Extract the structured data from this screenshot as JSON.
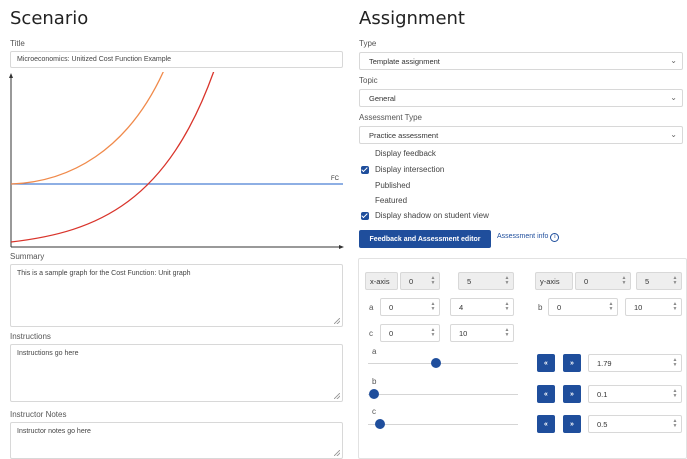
{
  "scenario": {
    "heading": "Scenario",
    "title_label": "Title",
    "title_value": "Microeconomics: Unitized Cost Function Example",
    "graph": {
      "line_label": "FC",
      "colors": {
        "fc": "#4a7fd4",
        "orange": "#f08a4b",
        "red": "#d9342b"
      }
    },
    "summary_label": "Summary",
    "summary_value": "This is a sample graph for the Cost Function: Unit graph",
    "instructions_label": "Instructions",
    "instructions_value": "Instructions go here",
    "notes_label": "Instructor Notes",
    "notes_value": "Instructor notes go here"
  },
  "assignment": {
    "heading": "Assignment",
    "type_label": "Type",
    "type_value": "Template assignment",
    "topic_label": "Topic",
    "topic_value": "General",
    "assessment_type_label": "Assessment Type",
    "assessment_type_value": "Practice assessment",
    "options": {
      "display_feedback": {
        "label": "Display feedback",
        "checked": false
      },
      "display_intersection": {
        "label": "Display intersection",
        "checked": true
      },
      "published": {
        "label": "Published",
        "checked": false
      },
      "featured": {
        "label": "Featured",
        "checked": false
      },
      "display_shadow": {
        "label": "Display shadow on student view",
        "checked": true
      }
    },
    "feedback_button": "Feedback and Assessment editor",
    "assessment_info_link": "Assessment info",
    "info_icon": "i"
  },
  "params": {
    "xaxis_label": "x-axis",
    "xaxis_min": "0",
    "xaxis_max": "5",
    "yaxis_label": "y-axis",
    "yaxis_min": "0",
    "yaxis_max": "5",
    "a_label": "a",
    "a_min": "0",
    "a_max": "4",
    "b_label": "b",
    "b_min": "0",
    "b_max": "10",
    "c_label": "c",
    "c_min": "0",
    "c_max": "10",
    "sliders": [
      {
        "label": "a",
        "value": "1.79",
        "fraction": 0.45
      },
      {
        "label": "b",
        "value": "0.1",
        "fraction": 0.01
      },
      {
        "label": "c",
        "value": "0.5",
        "fraction": 0.05
      }
    ],
    "prev_glyph": "«",
    "next_glyph": "»"
  }
}
